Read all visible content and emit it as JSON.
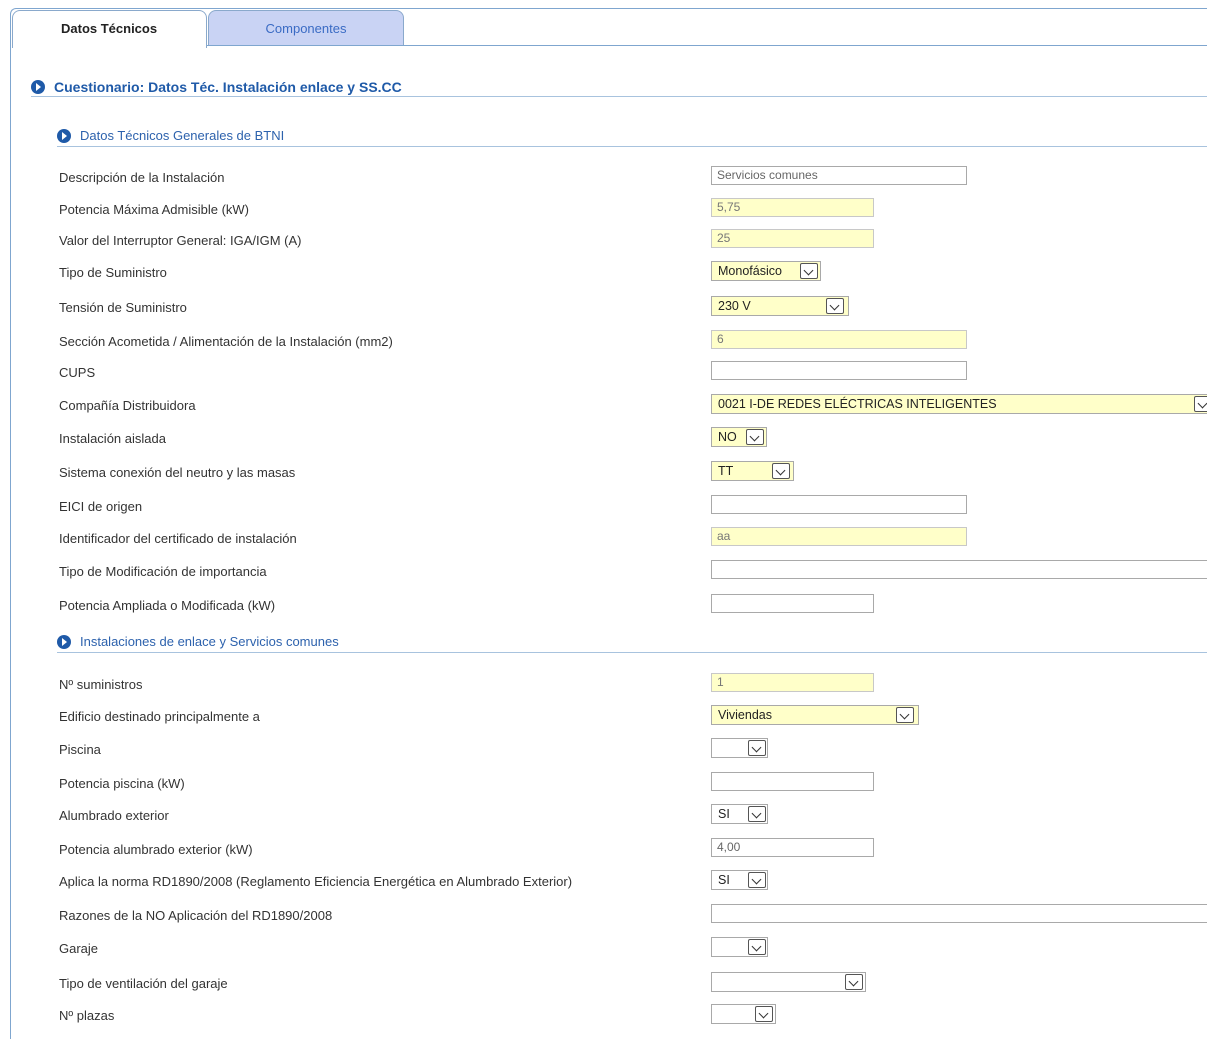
{
  "tabs": {
    "active": "Datos Técnicos",
    "inactive": "Componentes"
  },
  "main_section": "Cuestionario: Datos Téc. Instalación enlace y SS.CC",
  "section1": {
    "title": "Datos Técnicos Generales de BTNI",
    "rows": [
      {
        "label": "Descripción de la Instalación",
        "value": "Servicios comunes"
      },
      {
        "label": "Potencia Máxima Admisible (kW)",
        "value": "5,75"
      },
      {
        "label": "Valor del Interruptor General: IGA/IGM (A)",
        "value": "25"
      },
      {
        "label": "Tipo de Suministro",
        "value": "Monofásico"
      },
      {
        "label": "Tensión de Suministro",
        "value": "230 V"
      },
      {
        "label": "Sección Acometida / Alimentación de la Instalación (mm2)",
        "value": "6"
      },
      {
        "label": "CUPS",
        "value": ""
      },
      {
        "label": "Compañía Distribuidora",
        "value": "0021 I-DE REDES ELÉCTRICAS INTELIGENTES"
      },
      {
        "label": "Instalación aislada",
        "value": "NO"
      },
      {
        "label": "Sistema conexión del neutro y las masas",
        "value": "TT"
      },
      {
        "label": "EICI de origen",
        "value": ""
      },
      {
        "label": "Identificador del certificado de instalación",
        "value": "aa"
      },
      {
        "label": "Tipo de Modificación de importancia",
        "value": ""
      },
      {
        "label": "Potencia Ampliada o Modificada (kW)",
        "value": ""
      }
    ]
  },
  "section2": {
    "title": "Instalaciones de enlace y Servicios comunes",
    "rows": [
      {
        "label": "Nº suministros",
        "value": "1"
      },
      {
        "label": "Edificio destinado principalmente a",
        "value": "Viviendas"
      },
      {
        "label": "Piscina",
        "value": ""
      },
      {
        "label": "Potencia piscina (kW)",
        "value": ""
      },
      {
        "label": "Alumbrado exterior",
        "value": "SI"
      },
      {
        "label": "Potencia alumbrado exterior (kW)",
        "value": "4,00"
      },
      {
        "label": "Aplica la norma RD1890/2008 (Reglamento Eficiencia Energética en Alumbrado Exterior)",
        "value": "SI"
      },
      {
        "label": "Razones de la NO Aplicación del RD1890/2008",
        "value": ""
      },
      {
        "label": "Garaje",
        "value": ""
      },
      {
        "label": "Tipo de ventilación del garaje",
        "value": ""
      },
      {
        "label": "Nº plazas",
        "value": ""
      }
    ]
  },
  "colors": {
    "accent": "#1f5aa8",
    "required_field_bg": "#ffffc9",
    "inactive_tab_bg": "#c9d3f4"
  }
}
